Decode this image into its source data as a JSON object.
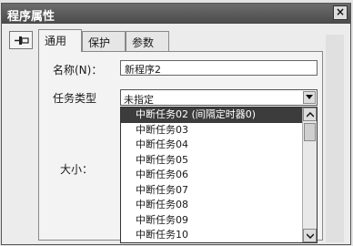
{
  "window": {
    "title": "程序属性",
    "close_label": "×"
  },
  "tabs": [
    {
      "label": "通用"
    },
    {
      "label": "保护"
    },
    {
      "label": "参数"
    }
  ],
  "form": {
    "name_label": "名称(N)：",
    "name_value": "新程序2",
    "task_type_label": "任务类型",
    "task_type_value": "未指定",
    "size_label": "大小："
  },
  "dropdown": {
    "options": [
      "中断任务02 (间隔定时器0)",
      "中断任务03",
      "中断任务04",
      "中断任务05",
      "中断任务06",
      "中断任务07",
      "中断任务08",
      "中断任务09",
      "中断任务10"
    ],
    "selected_index": 0
  },
  "colors": {
    "titlebar": "#5a5a5a",
    "selection": "#3c3c3c"
  }
}
